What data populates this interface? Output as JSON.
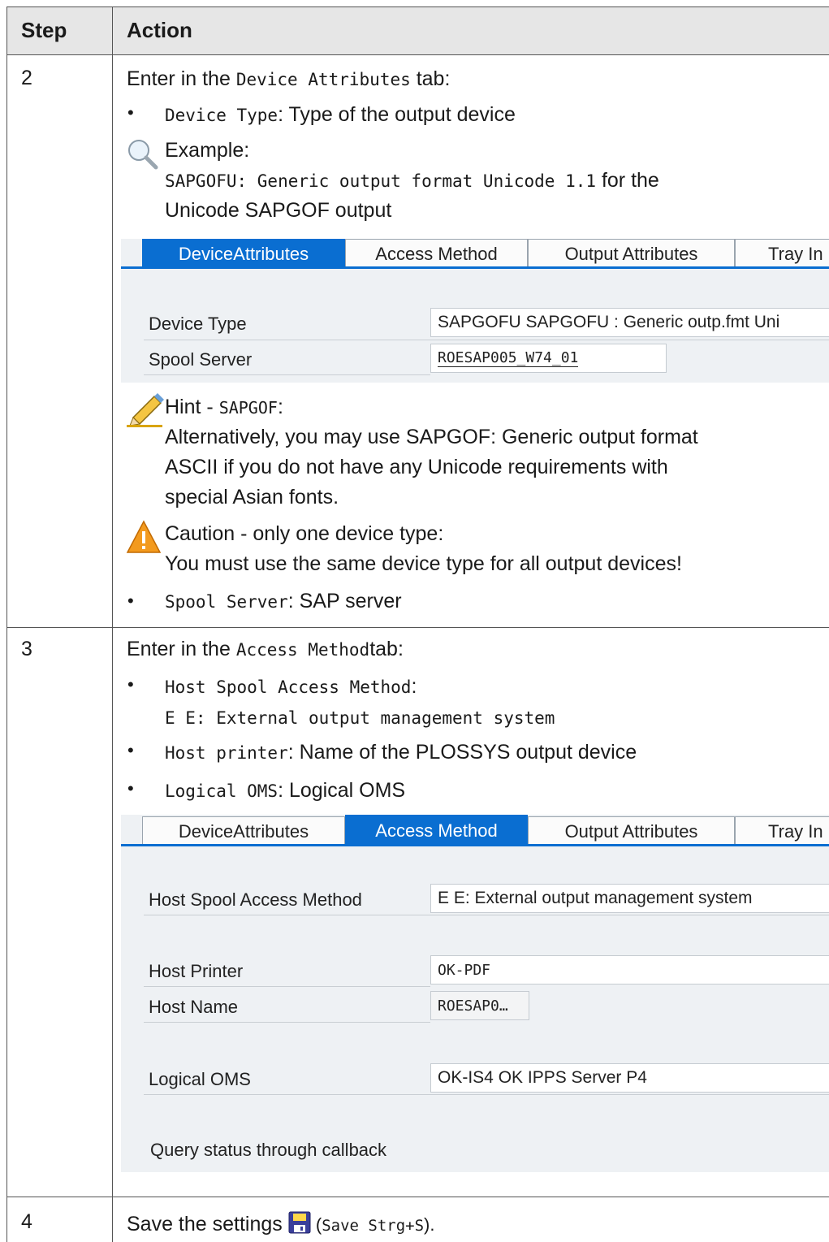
{
  "header": {
    "step": "Step",
    "action": "Action"
  },
  "step2": {
    "number": "2",
    "intro_pre": "Enter in the ",
    "intro_code": "Device Attributes",
    "intro_post": " tab:",
    "bullet_device_code": "Device Type",
    "bullet_device_text": ": Type of the output device",
    "example_title": "Example:",
    "example_code": "SAPGOFU: Generic output format Unicode 1.1",
    "example_text1": " for the",
    "example_text2": "Unicode SAPGOF output",
    "panel": {
      "tabs": [
        "DeviceAttributes",
        "Access Method",
        "Output Attributes",
        "Tray In"
      ],
      "device_type_label": "Device Type",
      "device_type_value": "SAPGOFU SAPGOFU  : Generic outp.fmt Uni",
      "spool_server_label": "Spool Server",
      "spool_server_value": "ROESAP005_W74_01"
    },
    "hint_title_pre": "Hint - ",
    "hint_title_code": "SAPGOF",
    "hint_title_post": ":",
    "hint_line1": "Alternatively, you may use SAPGOF: Generic output format",
    "hint_line2": "ASCII if you do not have any Unicode requirements with",
    "hint_line3": "special Asian fonts.",
    "caution_title": "Caution - only one device type:",
    "caution_text": "You must use the same device type for all output devices!",
    "bullet_spool_code": "Spool Server",
    "bullet_spool_text": ": SAP server"
  },
  "step3": {
    "number": "3",
    "intro_pre": "Enter in the ",
    "intro_code": "Access Method",
    "intro_post": "tab:",
    "b1_code": "Host Spool Access Method",
    "b1_post": ":",
    "b1_line2": "E E: External output management system",
    "b2_code": "Host printer",
    "b2_text": ": Name of the PLOSSYS output device",
    "b3_code": "Logical OMS",
    "b3_text": ": Logical OMS",
    "panel": {
      "tabs": [
        "DeviceAttributes",
        "Access Method",
        "Output Attributes",
        "Tray In"
      ],
      "hsam_label": "Host Spool Access Method",
      "hsam_value": "E E: External output management system",
      "host_printer_label": "Host Printer",
      "host_printer_value": "OK-PDF",
      "host_name_label": "Host Name",
      "host_name_value": "ROESAP0…",
      "logical_oms_label": "Logical OMS",
      "logical_oms_value": "OK-IS4 OK IPPS Server P4",
      "query_status_label": "Query status through callback"
    }
  },
  "step4": {
    "number": "4",
    "text_pre": "Save the settings ",
    "text_paren_open": " (",
    "text_code": "Save Strg+S",
    "text_paren_close": ")."
  },
  "colors": {
    "sap_blue": "#0a6ed1",
    "panel_bg": "#eef1f4",
    "header_bg": "#e6e6e6"
  },
  "icons": [
    "magnifier-icon",
    "pencil-icon",
    "warning-icon",
    "save-icon"
  ]
}
